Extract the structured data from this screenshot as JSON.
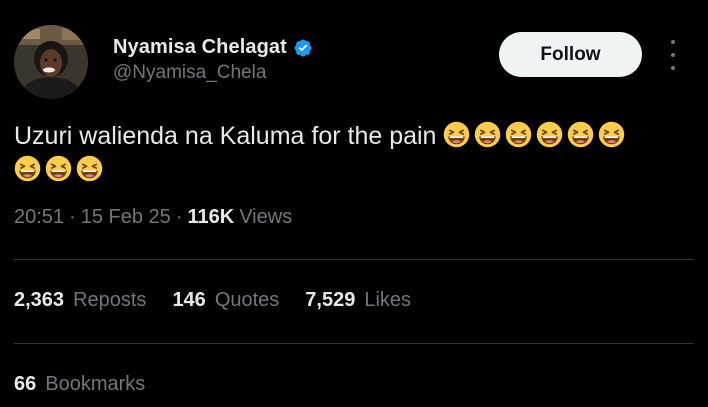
{
  "user": {
    "display_name": "Nyamisa Chelagat",
    "handle": "@Nyamisa_Chela",
    "verified": true
  },
  "actions": {
    "follow_label": "Follow",
    "more_icon": "more-vertical-icon"
  },
  "tweet": {
    "text": "Uzuri walienda na Kaluma for the pain",
    "emoji": "grinning-squinting-face",
    "emoji_count": 9
  },
  "meta": {
    "time": "20:51",
    "separator": "·",
    "date": "15 Feb 25",
    "views_count": "116K",
    "views_label": "Views"
  },
  "stats": {
    "reposts": {
      "count": "2,363",
      "label": "Reposts"
    },
    "quotes": {
      "count": "146",
      "label": "Quotes"
    },
    "likes": {
      "count": "7,529",
      "label": "Likes"
    },
    "bookmarks": {
      "count": "66",
      "label": "Bookmarks"
    }
  },
  "colors": {
    "background": "#000000",
    "text_primary": "#e7e9ea",
    "text_secondary": "#71767b",
    "verified_blue": "#1d9bf0",
    "follow_button_bg": "#eff3f4",
    "divider": "#2f3336"
  }
}
